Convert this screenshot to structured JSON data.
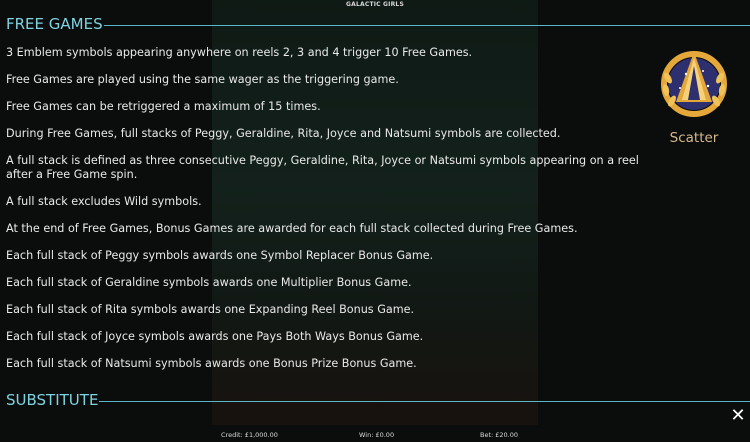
{
  "game": {
    "title": "GALACTIC GIRLS"
  },
  "free_games": {
    "heading": "FREE GAMES",
    "paragraphs": [
      "3 Emblem symbols appearing anywhere on reels 2, 3 and 4 trigger 10 Free Games.",
      "Free Games are played using the same wager as the triggering game.",
      "Free Games can be retriggered a maximum of 15 times.",
      "During Free Games, full stacks of Peggy, Geraldine, Rita, Joyce and Natsumi symbols are collected.",
      "A full stack is defined as three consecutive Peggy, Geraldine, Rita, Joyce or Natsumi symbols appearing on a reel after a Free Game spin.",
      "A full stack excludes Wild symbols.",
      "At the end of Free Games, Bonus Games are awarded for each full stack collected during Free Games.",
      "Each full stack of Peggy symbols awards one Symbol Replacer Bonus Game.",
      "Each full stack of Geraldine symbols awards one Multiplier Bonus Game.",
      "Each full stack of Rita symbols awards one Expanding Reel Bonus Game.",
      "Each full stack of Joyce symbols awards one Pays Both Ways Bonus Game.",
      "Each full stack of Natsumi symbols awards one Bonus Prize Bonus Game."
    ],
    "symbol": {
      "label": "Scatter",
      "icon": "emblem-icon"
    }
  },
  "substitute": {
    "heading": "SUBSTITUTE"
  },
  "controls": {
    "close_icon": "close-icon",
    "close_glyph": "✕"
  },
  "status": {
    "credit": "Credit: £1,000.00",
    "win": "Win: £0.00",
    "bet": "Bet: £20.00"
  },
  "colors": {
    "heading": "#7fd3e1",
    "symbol_label": "#d7b88a",
    "emblem_gold": "#e3a73a",
    "emblem_navy": "#2d2f6e"
  }
}
